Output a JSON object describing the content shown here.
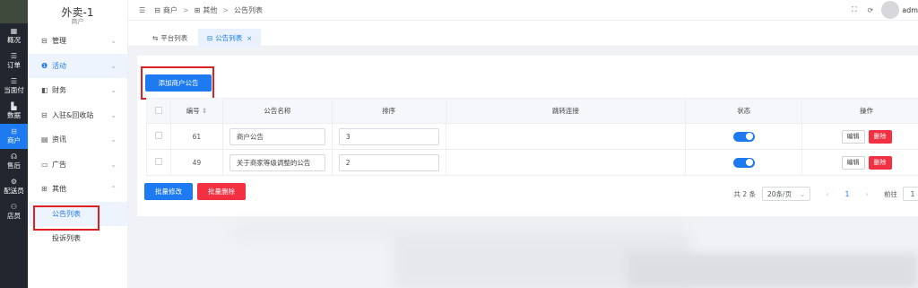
{
  "rail": [
    {
      "label": "概况",
      "icon": "grid-icon"
    },
    {
      "label": "订单",
      "icon": "list-icon"
    },
    {
      "label": "当面付",
      "icon": "list-icon"
    },
    {
      "label": "数据",
      "icon": "bar-chart-icon"
    },
    {
      "label": "商户",
      "icon": "store-icon",
      "active": true
    },
    {
      "label": "售后",
      "icon": "headset-icon"
    },
    {
      "label": "配送员",
      "icon": "bike-icon"
    },
    {
      "label": "店员",
      "icon": "user-icon"
    }
  ],
  "sidebar": {
    "title": "外卖-1",
    "subtitle": "商户",
    "items": [
      {
        "label": "管理",
        "icon": "store-icon",
        "chev": "⌄"
      },
      {
        "label": "活动",
        "icon": "activity-icon",
        "chev": "⌄",
        "active": true
      },
      {
        "label": "财务",
        "icon": "finance-icon",
        "chev": "⌄"
      },
      {
        "label": "入驻&回收站",
        "icon": "store-icon",
        "chev": "⌄"
      },
      {
        "label": "资讯",
        "icon": "news-icon",
        "chev": "⌄"
      },
      {
        "label": "广告",
        "icon": "monitor-icon",
        "chev": "⌄"
      },
      {
        "label": "其他",
        "icon": "apps-icon",
        "chev": "⌃"
      }
    ],
    "sub": [
      {
        "label": "公告列表",
        "active": true
      },
      {
        "label": "投诉列表"
      }
    ]
  },
  "breadcrumb": {
    "items": [
      "商户",
      "其他",
      "公告列表"
    ],
    "sep": ">"
  },
  "header": {
    "user": "adm"
  },
  "tabs": [
    {
      "label": "平台列表"
    },
    {
      "label": "公告列表",
      "close": "×",
      "active": true
    }
  ],
  "actions": {
    "add": "添加商户公告",
    "batch_edit": "批量修改",
    "batch_delete": "批量删除"
  },
  "table": {
    "headers": [
      "编号",
      "公告名称",
      "排序",
      "跳转连接",
      "状态",
      "操作"
    ],
    "rows": [
      {
        "id": "61",
        "name": "商户公告",
        "sort": "3",
        "link": "",
        "status": true
      },
      {
        "id": "49",
        "name": "关于商家等级调整的公告",
        "sort": "2",
        "link": "",
        "status": true
      }
    ],
    "edit_label": "编辑",
    "delete_label": "删除"
  },
  "pagination": {
    "total": "共 2 条",
    "page_size": "20条/页",
    "current": "1",
    "goto": "前往",
    "goto_value": "1"
  },
  "colors": {
    "accent": "#1e7af0",
    "danger": "#f23042",
    "rail_bg": "#22262e"
  }
}
